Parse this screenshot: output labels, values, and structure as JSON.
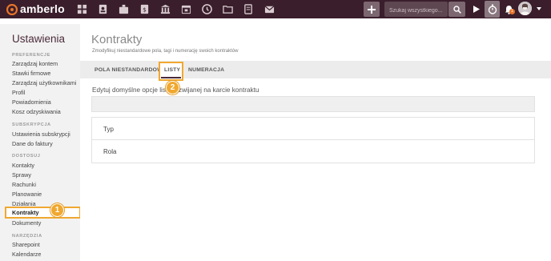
{
  "header": {
    "logo_text": "amberlo",
    "nav_icons": [
      "dashboard-icon",
      "contacts-icon",
      "cases-icon",
      "billing-icon",
      "bank-icon",
      "calendar-icon",
      "history-icon",
      "folder-icon",
      "documents-icon",
      "mail-icon"
    ],
    "search_placeholder": "Szukaj wszystkiego...",
    "notification_count": "1"
  },
  "sidebar": {
    "title": "Ustawienia",
    "sections": [
      {
        "label": "PREFERENCJE",
        "items": [
          "Zarządzaj kontem",
          "Stawki firmowe",
          "Zarządzaj użytkownikami",
          "Profil",
          "Powiadomienia",
          "Kosz odzyskiwania"
        ]
      },
      {
        "label": "SUBSKRYPCJA",
        "items": [
          "Ustawienia subskrypcji",
          "Dane do faktury"
        ]
      },
      {
        "label": "DOSTOSUJ",
        "items": [
          "Kontakty",
          "Sprawy",
          "Rachunki",
          "Planowanie",
          "Działania",
          "Kontrakty",
          "Dokumenty"
        ]
      },
      {
        "label": "NARZĘDZIA",
        "items": [
          "Sharepoint",
          "Kalendarze"
        ]
      }
    ],
    "active_item": "Kontrakty"
  },
  "main": {
    "title": "Kontrakty",
    "subtitle": "Zmodyfikuj niestandardowe pola, tagi i numerację swoich kontraktów",
    "tabs": [
      {
        "label": "POLA NIESTANDARDOWE"
      },
      {
        "label": "LISTY"
      },
      {
        "label": "NUMERACJA"
      }
    ],
    "active_tab": "LISTY",
    "section_label": "Edytuj domyślne opcje listy rozwijanej na karcie kontraktu",
    "rows": [
      "Typ",
      "Rola"
    ]
  },
  "callouts": [
    "1",
    "2"
  ],
  "colors": {
    "topbar": "#3a1e2b",
    "accent": "#4b2b39",
    "highlight": "#f0a830"
  }
}
